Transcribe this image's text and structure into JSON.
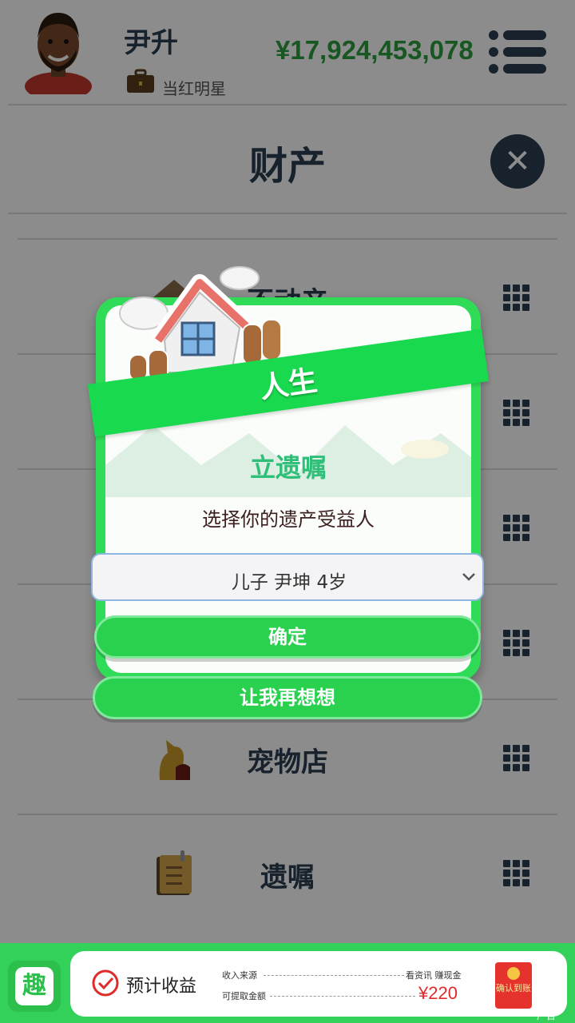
{
  "header": {
    "player_name": "尹升",
    "player_title": "当红明星",
    "money": "¥17,924,453,078"
  },
  "section": {
    "title": "财产",
    "items": [
      {
        "label": "不动产",
        "icon": "house-icon"
      },
      {
        "label": "",
        "icon": ""
      },
      {
        "label": "",
        "icon": ""
      },
      {
        "label": "",
        "icon": ""
      },
      {
        "label": "宠物店",
        "icon": "dog-icon"
      },
      {
        "label": "遗嘱",
        "icon": "notebook-icon"
      }
    ]
  },
  "modal": {
    "ribbon": "人生",
    "title": "立遗嘱",
    "subtitle": "选择你的遗产受益人",
    "select_value": "儿子 尹坤 4岁",
    "confirm_label": "确定",
    "rethink_label": "让我再想想"
  },
  "ad": {
    "logo_char": "趣",
    "label": "预计收益",
    "row1_left": "收入来源",
    "row1_right": "看资讯 赚现金",
    "row2_left": "可提取金额",
    "amount": "¥220",
    "redpack_text": "确认到账",
    "tag": "广告"
  },
  "colors": {
    "accent_green": "#2fdb57",
    "money_green": "#2e9e3e",
    "dark_navy": "#2c3e50",
    "amount_red": "#e02b2b"
  }
}
